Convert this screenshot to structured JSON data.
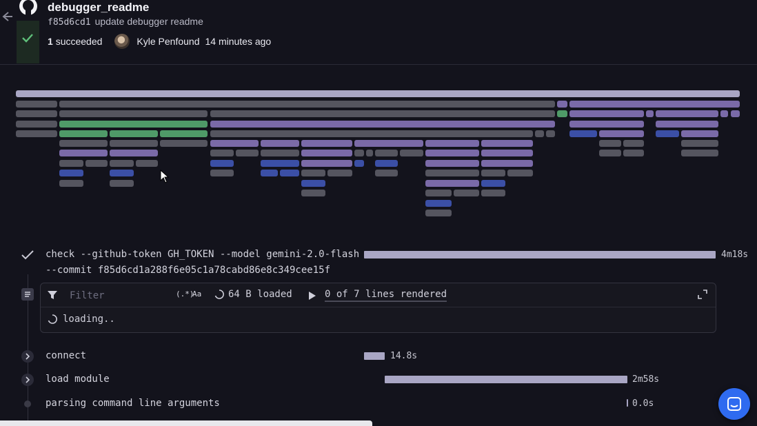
{
  "header": {
    "title": "debugger_readme",
    "commit_hash": "f85d6cd1",
    "commit_message": "update debugger readme",
    "succeeded_count": "1",
    "succeeded_label": "succeeded",
    "author": "Kyle Penfound",
    "time_ago": "14 minutes ago"
  },
  "colors": {
    "accent_green": "#4f9a68",
    "flame_gray": "#55555f",
    "flame_purple": "#7a6aa8",
    "flame_blue": "#3b4fa6",
    "flame_lavender": "#a9a6c4",
    "chat_blue": "#2f6bf0"
  },
  "steps": {
    "main": {
      "command_line1": "check --github-token GH_TOKEN --model gemini-2.0-flash",
      "command_line2": "--commit f85d6cd1a288f6e05c1a78cabd86e8c349cee15f",
      "duration": "4m18s",
      "progress": 1.0
    },
    "log": {
      "filter_placeholder": "Filter",
      "regex_label": "(.*)",
      "case_label": "Aa",
      "loaded_text": "64 B loaded",
      "rendered_text": "0 of 7 lines rendered",
      "loading_text": "loading.."
    },
    "connect": {
      "label": "connect",
      "duration": "14.8s"
    },
    "load_module": {
      "label": "load module",
      "duration": "2m58s"
    },
    "parsing": {
      "label": "parsing command line arguments",
      "duration": "0.0s"
    }
  },
  "icons": [
    "back-arrow-icon",
    "github-icon",
    "check-icon",
    "log-icon",
    "filter-icon",
    "spinner-icon",
    "play-icon",
    "expand-icon",
    "chevron-right-icon",
    "chat-icon",
    "cursor-icon"
  ]
}
